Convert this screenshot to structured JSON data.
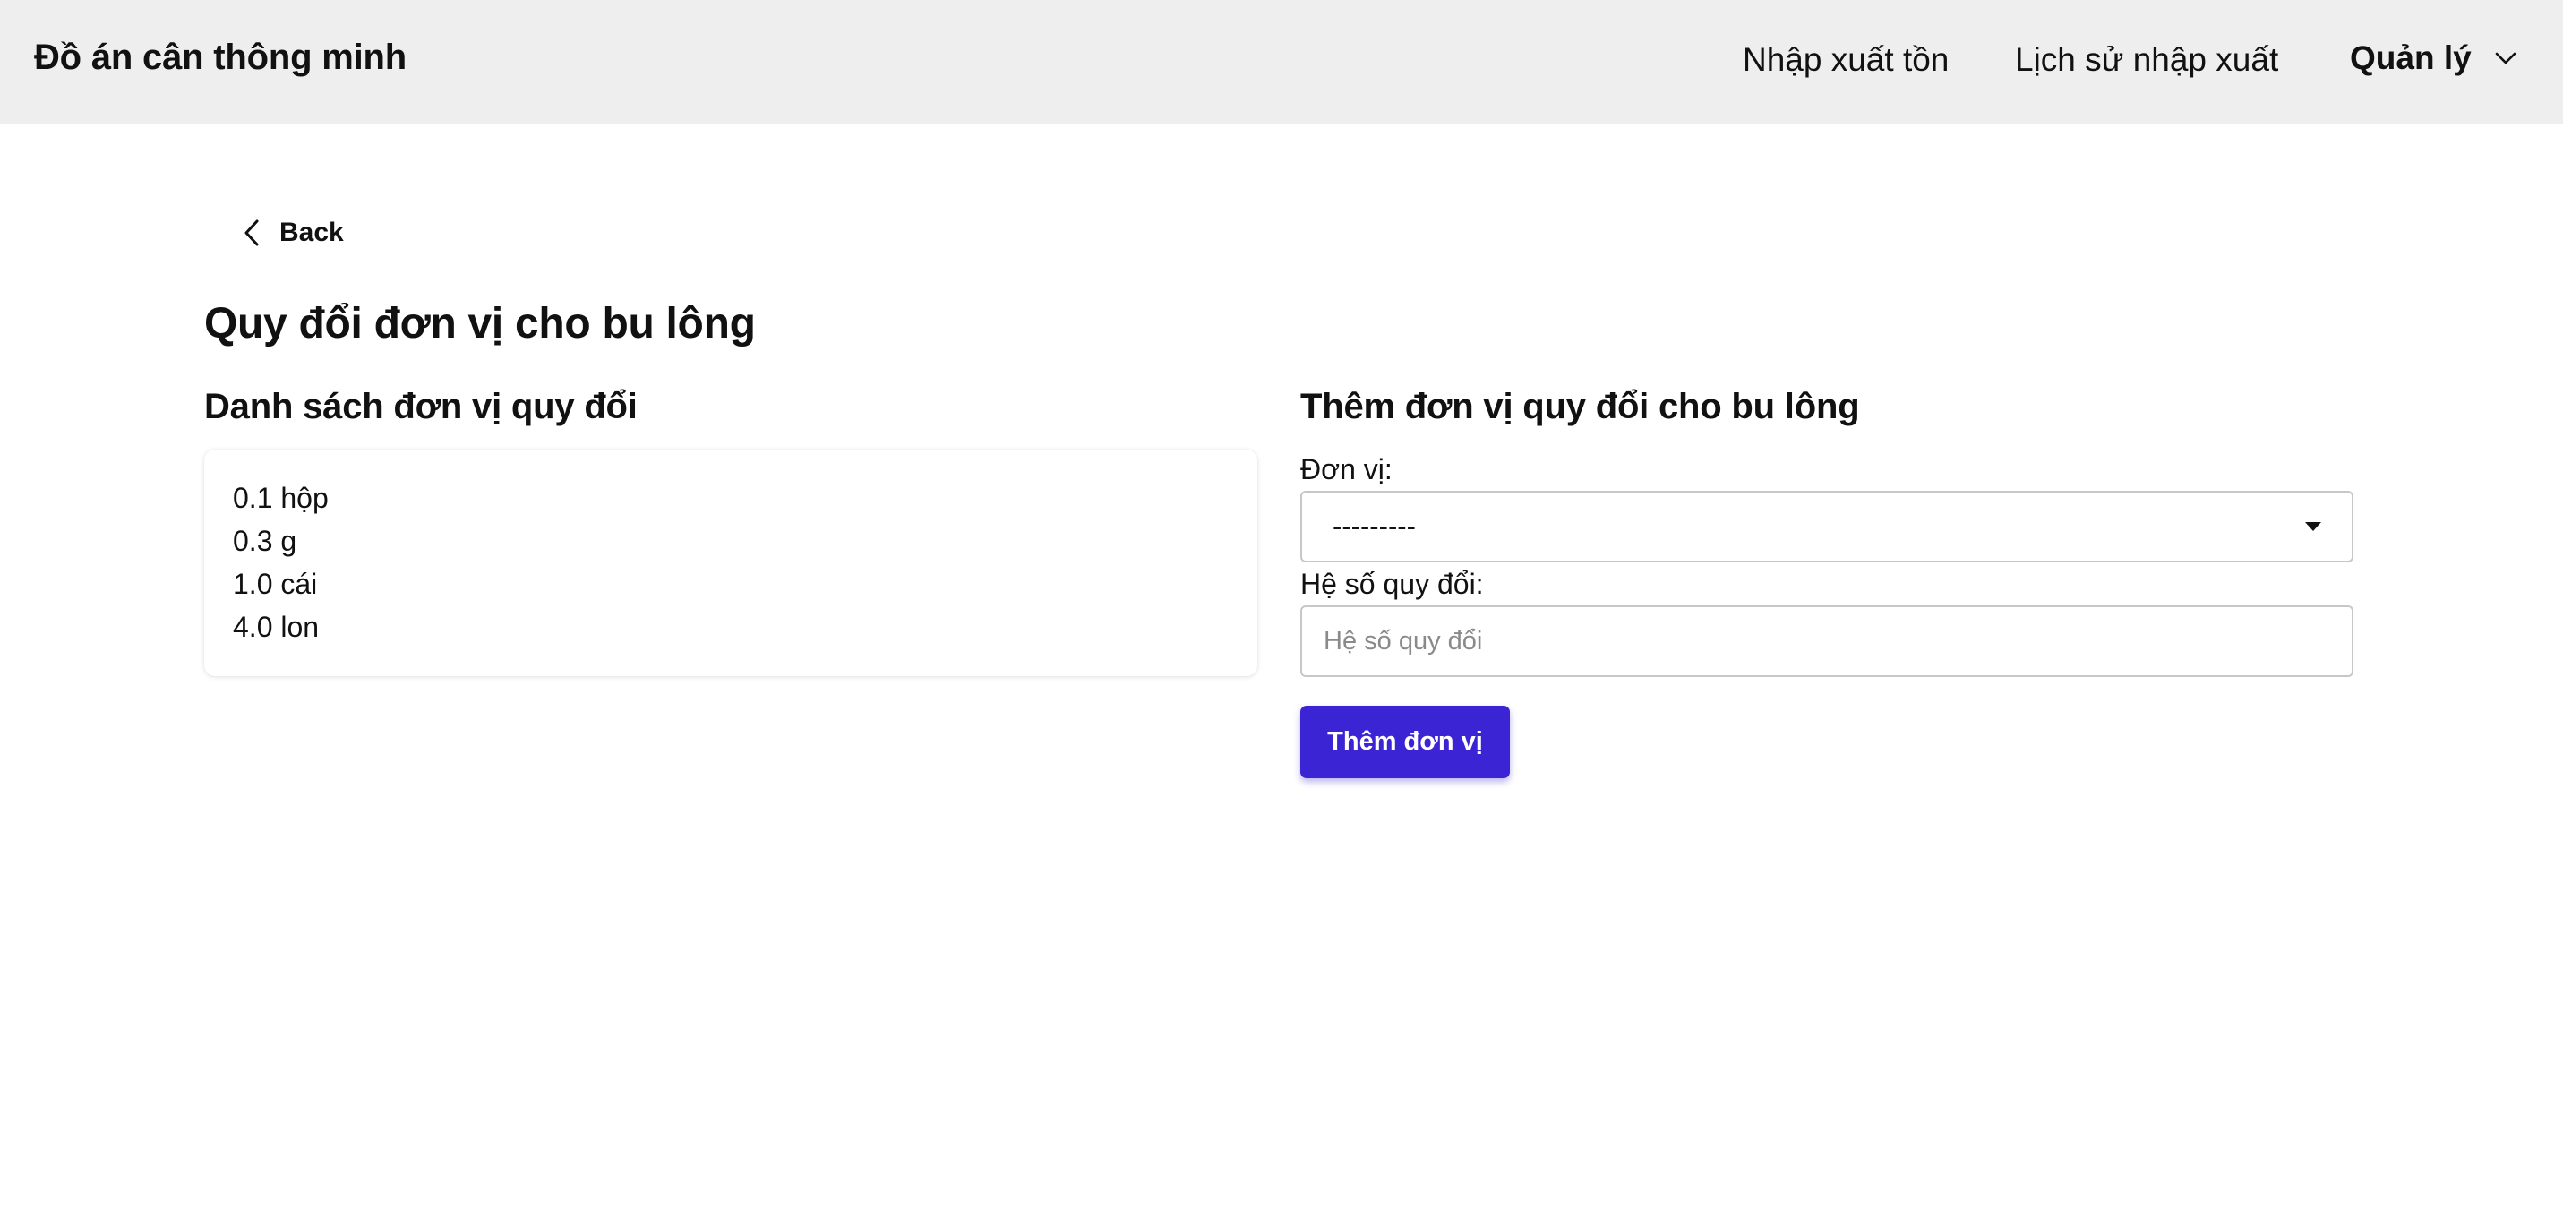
{
  "navbar": {
    "brand": "Đồ án cân thông minh",
    "links": [
      {
        "label": "Nhập xuất tồn"
      },
      {
        "label": "Lịch sử nhập xuất"
      }
    ],
    "dropdown": {
      "label": "Quản lý",
      "icon": "chevron-down-icon"
    }
  },
  "back": {
    "label": "Back",
    "icon": "chevron-left-icon"
  },
  "page": {
    "title": "Quy đổi đơn vị cho bu lông"
  },
  "list_section": {
    "title": "Danh sách đơn vị quy đổi",
    "items": [
      "0.1 hộp",
      "0.3 g",
      "1.0 cái",
      "4.0 lon"
    ]
  },
  "form_section": {
    "title": "Thêm đơn vị quy đổi cho bu lông",
    "unit_label": "Đơn vị:",
    "unit_selected": "---------",
    "factor_label": "Hệ số quy đổi:",
    "factor_placeholder": "Hệ số quy đổi",
    "factor_value": "",
    "submit_label": "Thêm đơn vị"
  },
  "colors": {
    "navbar_bg": "#eeeeee",
    "primary_button": "#3a24d4"
  }
}
